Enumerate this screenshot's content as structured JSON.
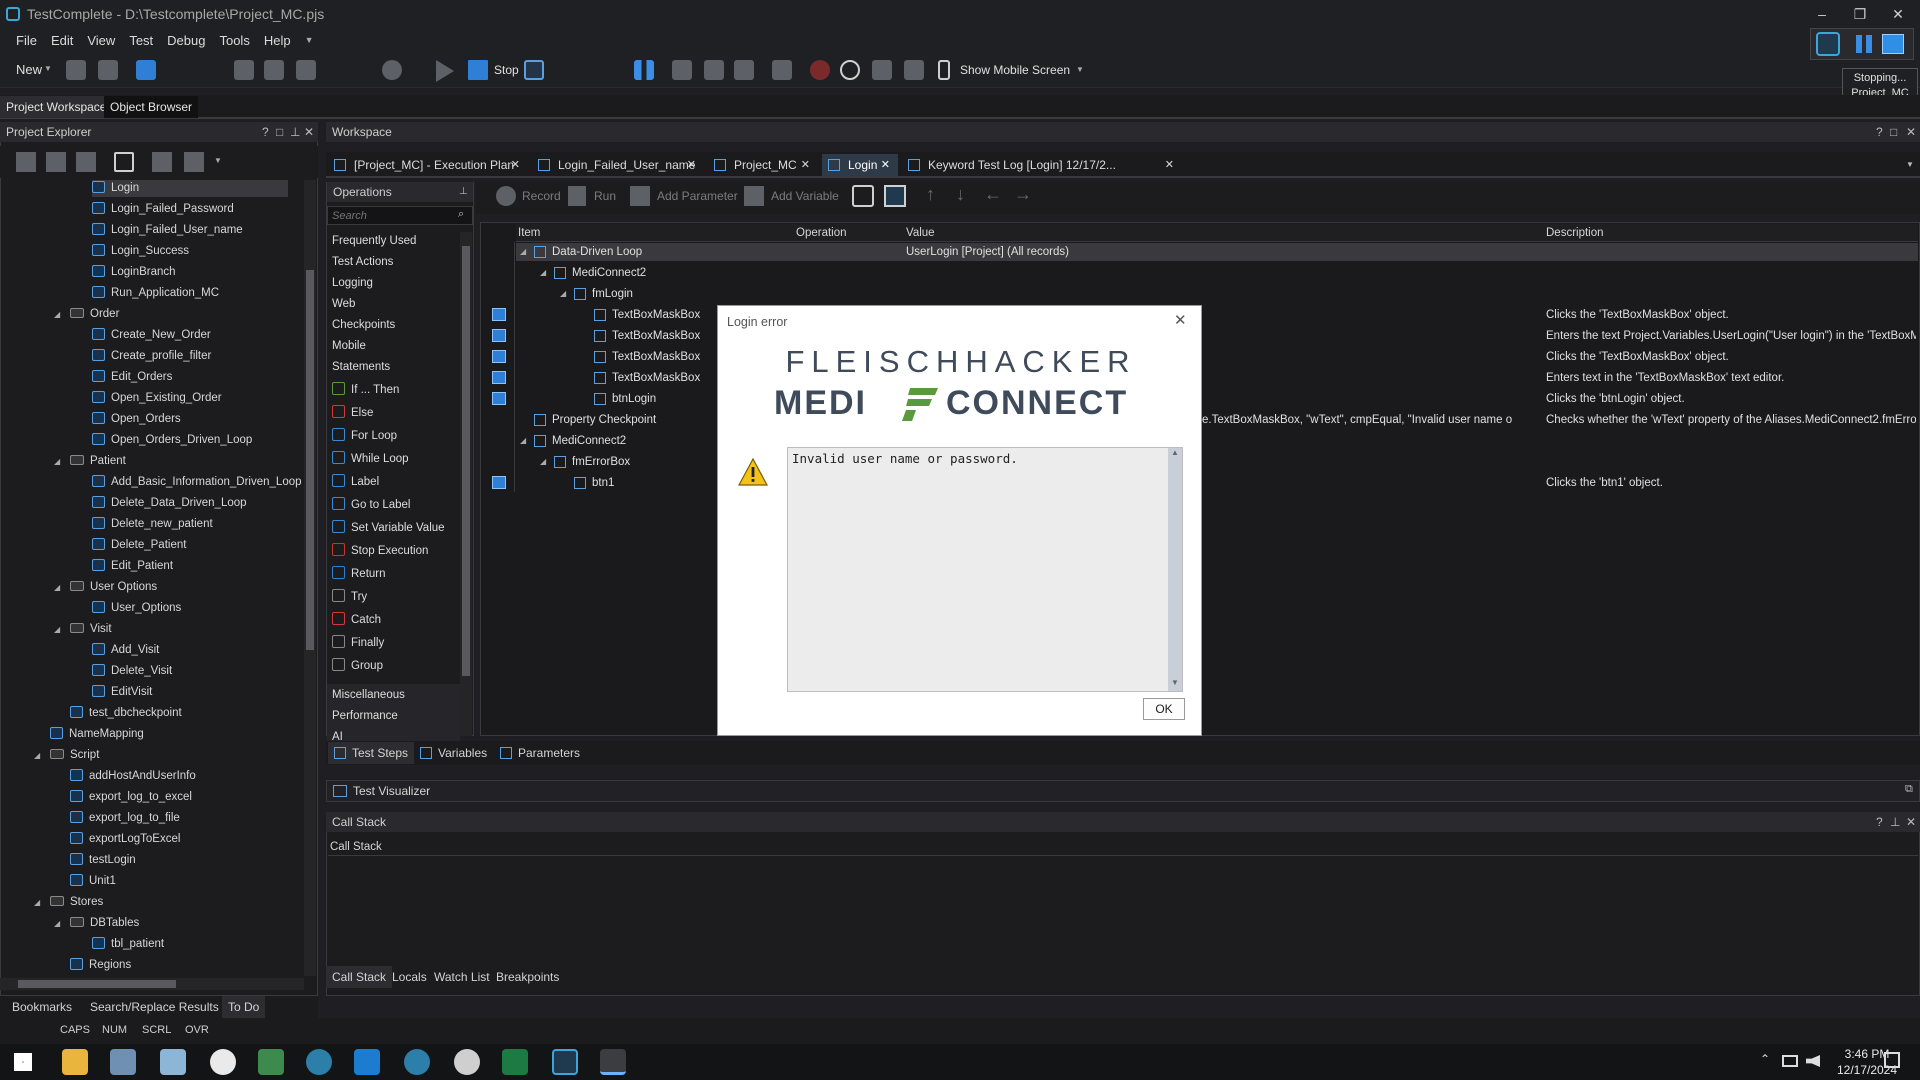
{
  "window": {
    "title": "TestComplete - D:\\Testcomplete\\Project_MC.pjs",
    "minimize": "–",
    "restore": "❐",
    "close": "✕"
  },
  "menu": [
    "File",
    "Edit",
    "View",
    "Test",
    "Debug",
    "Tools",
    "Help"
  ],
  "toolbar": {
    "new_label": "New",
    "stop_label": "Stop",
    "mobile_label": "Show Mobile Screen"
  },
  "recorder": {
    "status": "Stopping...",
    "project": "Project_MC"
  },
  "workspace_tabs": {
    "left": [
      "Project Workspace",
      "Object Browser"
    ]
  },
  "project_explorer": {
    "title": "Project Explorer",
    "items": [
      {
        "label": "Login",
        "level": 4,
        "type": "test"
      },
      {
        "label": "Login_Failed_Password",
        "level": 4,
        "type": "test"
      },
      {
        "label": "Login_Failed_User_name",
        "level": 4,
        "type": "test"
      },
      {
        "label": "Login_Success",
        "level": 4,
        "type": "test"
      },
      {
        "label": "LoginBranch",
        "level": 4,
        "type": "test"
      },
      {
        "label": "Run_Application_MC",
        "level": 4,
        "type": "test"
      },
      {
        "label": "Order",
        "level": 3,
        "type": "folder"
      },
      {
        "label": "Create_New_Order",
        "level": 4,
        "type": "test"
      },
      {
        "label": "Create_profile_filter",
        "level": 4,
        "type": "test"
      },
      {
        "label": "Edit_Orders",
        "level": 4,
        "type": "test"
      },
      {
        "label": "Open_Existing_Order",
        "level": 4,
        "type": "test"
      },
      {
        "label": "Open_Orders",
        "level": 4,
        "type": "test"
      },
      {
        "label": "Open_Orders_Driven_Loop",
        "level": 4,
        "type": "test"
      },
      {
        "label": "Patient",
        "level": 3,
        "type": "folder"
      },
      {
        "label": "Add_Basic_Information_Driven_Loop",
        "level": 4,
        "type": "test"
      },
      {
        "label": "Delete_Data_Driven_Loop",
        "level": 4,
        "type": "test"
      },
      {
        "label": "Delete_new_patient",
        "level": 4,
        "type": "test"
      },
      {
        "label": "Delete_Patient",
        "level": 4,
        "type": "test"
      },
      {
        "label": "Edit_Patient",
        "level": 4,
        "type": "test"
      },
      {
        "label": "User Options",
        "level": 3,
        "type": "folder"
      },
      {
        "label": "User_Options",
        "level": 4,
        "type": "test"
      },
      {
        "label": "Visit",
        "level": 3,
        "type": "folder"
      },
      {
        "label": "Add_Visit",
        "level": 4,
        "type": "test"
      },
      {
        "label": "Delete_Visit",
        "level": 4,
        "type": "test"
      },
      {
        "label": "EditVisit",
        "level": 4,
        "type": "test"
      },
      {
        "label": "test_dbcheckpoint",
        "level": 3,
        "type": "test"
      },
      {
        "label": "NameMapping",
        "level": 2,
        "type": "test"
      },
      {
        "label": "Script",
        "level": 2,
        "type": "folder"
      },
      {
        "label": "addHostAndUserInfo",
        "level": 3,
        "type": "test"
      },
      {
        "label": "export_log_to_excel",
        "level": 3,
        "type": "test"
      },
      {
        "label": "export_log_to_file",
        "level": 3,
        "type": "test"
      },
      {
        "label": "exportLogToExcel",
        "level": 3,
        "type": "test"
      },
      {
        "label": "testLogin",
        "level": 3,
        "type": "test"
      },
      {
        "label": "Unit1",
        "level": 3,
        "type": "test"
      },
      {
        "label": "Stores",
        "level": 2,
        "type": "folder"
      },
      {
        "label": "DBTables",
        "level": 3,
        "type": "folder"
      },
      {
        "label": "tbl_patient",
        "level": 4,
        "type": "test"
      },
      {
        "label": "Regions",
        "level": 3,
        "type": "test"
      }
    ]
  },
  "workspace": {
    "title": "Workspace",
    "tabs": [
      "[Project_MC] - Execution Plan",
      "Login_Failed_User_name",
      "Project_MC",
      "Login",
      "Keyword Test Log [Login] 12/17/2..."
    ],
    "active_tab": "Login"
  },
  "operations": {
    "title": "Operations",
    "search_placeholder": "Search",
    "categories": [
      "Frequently Used",
      "Test Actions",
      "Logging",
      "Web",
      "Checkpoints",
      "Mobile",
      "Statements"
    ],
    "statements": [
      "If ... Then",
      "Else",
      "For Loop",
      "While Loop",
      "Label",
      "Go to Label",
      "Set Variable Value",
      "Stop Execution",
      "Return",
      "Try",
      "Catch",
      "Finally",
      "Group"
    ],
    "more": [
      "Miscellaneous",
      "Performance",
      "AI"
    ]
  },
  "kt_toolbar": {
    "record": "Record",
    "run": "Run",
    "add_parameter": "Add Parameter",
    "add_variable": "Add Variable"
  },
  "grid": {
    "columns": [
      "Item",
      "Operation",
      "Value",
      "Description"
    ],
    "rows": [
      {
        "item": "Data-Driven Loop",
        "value": "UserLogin [Project] (All records)",
        "description": "",
        "indent": 0
      },
      {
        "item": "MediConnect2",
        "value": "",
        "description": "",
        "indent": 1
      },
      {
        "item": "fmLogin",
        "value": "",
        "description": "",
        "indent": 2
      },
      {
        "item": "TextBoxMaskBox",
        "value": "",
        "description": "Clicks the 'TextBoxMaskBox' object.",
        "indent": 3
      },
      {
        "item": "TextBoxMaskBox",
        "value": "",
        "description": "Enters the text Project.Variables.UserLogin(\"User login\") in the 'TextBoxM...",
        "indent": 3
      },
      {
        "item": "TextBoxMaskBox",
        "value": "",
        "description": "Clicks the 'TextBoxMaskBox' object.",
        "indent": 3
      },
      {
        "item": "TextBoxMaskBox",
        "value": "",
        "description": "Enters text in the 'TextBoxMaskBox' text editor.",
        "indent": 3
      },
      {
        "item": "btnLogin",
        "value": "",
        "description": "Clicks the 'btnLogin' object.",
        "indent": 3
      },
      {
        "item": "Property Checkpoint",
        "value": "e.TextBoxMaskBox, \"wText\", cmpEqual, \"Invalid user name or pass...",
        "description": "Checks whether the 'wText' property of the Aliases.MediConnect2.fmError...",
        "indent": 0
      },
      {
        "item": "MediConnect2",
        "value": "",
        "description": "",
        "indent": 0
      },
      {
        "item": "fmErrorBox",
        "value": "",
        "description": "",
        "indent": 1
      },
      {
        "item": "btn1",
        "value": "",
        "description": "Clicks the 'btn1' object.",
        "indent": 2
      }
    ]
  },
  "bottom_tabs": [
    "Test Steps",
    "Variables",
    "Parameters"
  ],
  "test_visualizer": "Test Visualizer",
  "call_stack": {
    "title": "Call Stack",
    "header": "Call Stack",
    "tabs": [
      "Call Stack",
      "Locals",
      "Watch List",
      "Breakpoints"
    ]
  },
  "left_bottom_tabs": [
    "Bookmarks",
    "Search/Replace Results",
    "To Do"
  ],
  "status": [
    "CAPS",
    "NUM",
    "SCRL",
    "OVR"
  ],
  "dialog": {
    "title": "Login error",
    "logo_top": "FLEISCHHACKER",
    "logo_left": "MEDI",
    "logo_right": "CONNECT",
    "message": "Invalid user name or password.",
    "ok": "OK"
  },
  "clock": {
    "time": "3:46 PM",
    "date": "12/17/2024"
  }
}
